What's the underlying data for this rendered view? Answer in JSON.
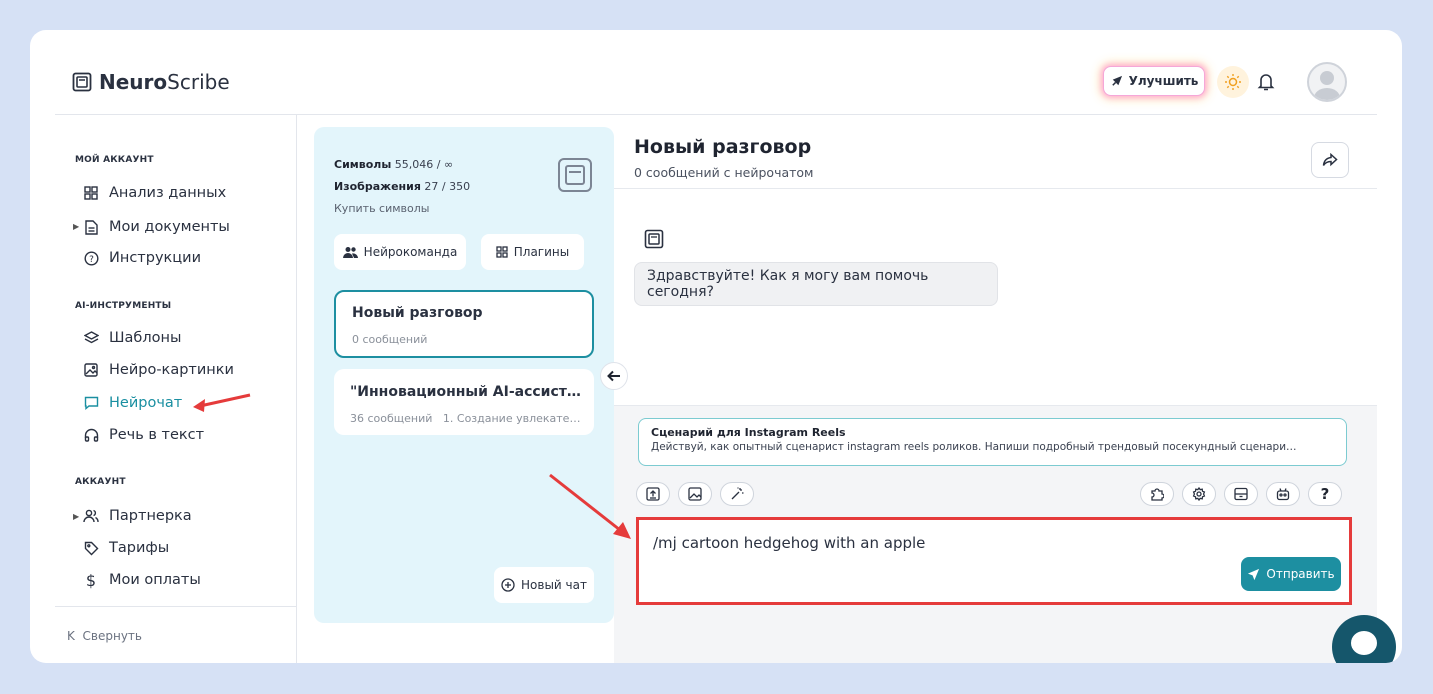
{
  "brand": {
    "bold": "Neuro",
    "light": "Scribe"
  },
  "header": {
    "upgrade_label": "Улучшить"
  },
  "sidebar": {
    "section_account": "МОЙ АККАУНТ",
    "section_ai": "AI-ИНСТРУМЕНТЫ",
    "section_profile": "АККАУНТ",
    "items": [
      {
        "label": "Анализ данных",
        "icon": "grid-icon"
      },
      {
        "label": "Мои документы",
        "icon": "document-icon"
      },
      {
        "label": "Инструкции",
        "icon": "help-circle-icon"
      },
      {
        "label": "Шаблоны",
        "icon": "layers-icon"
      },
      {
        "label": "Нейро-картинки",
        "icon": "image-icon"
      },
      {
        "label": "Нейрочат",
        "icon": "chat-icon",
        "active": true
      },
      {
        "label": "Речь в текст",
        "icon": "headphones-icon"
      },
      {
        "label": "Партнерка",
        "icon": "users-icon"
      },
      {
        "label": "Тарифы",
        "icon": "tag-icon"
      },
      {
        "label": "Мои оплаты",
        "icon": "dollar-icon"
      }
    ],
    "collapse_label": "Свернуть"
  },
  "stats": {
    "symbols_label": "Символы",
    "symbols_value": "55,046 / ∞",
    "images_label": "Изображения",
    "images_value": "27 / 350",
    "buy_label": "Купить символы"
  },
  "buttons": {
    "team": "Нейрокоманда",
    "plugins": "Плагины",
    "new_chat": "Новый чат",
    "send": "Отправить"
  },
  "conversations": [
    {
      "title": "Новый разговор",
      "subtitle": "0 сообщений",
      "active": true
    },
    {
      "title": "\"Инновационный AI-ассист…",
      "subtitle": "36 сообщений   1. Создание увлекате…"
    }
  ],
  "chat": {
    "title": "Новый разговор",
    "subtitle": "0 сообщений с нейрочатом",
    "greeting": "Здравствуйте! Как я могу вам помочь сегодня?",
    "template_title": "Сценарий для Instagram Reels",
    "template_desc": "Действуй, как опытный сценарист instagram reels роликов. Напиши подробный трендовый посекундный сценари…",
    "input_value": "/mj cartoon hedgehog with an apple",
    "help_label": "?"
  },
  "colors": {
    "accent": "#1d8fa1",
    "highlight": "#e53b3b",
    "panel": "#e3f5fb"
  }
}
